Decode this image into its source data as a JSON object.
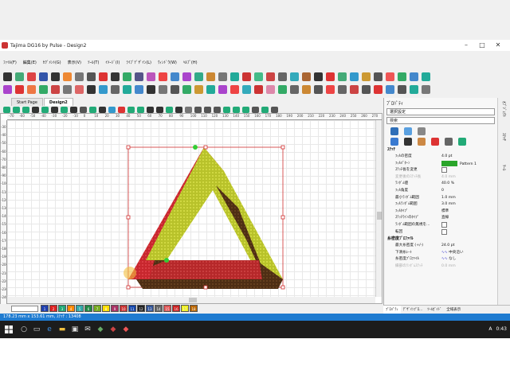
{
  "window": {
    "title": "Tajima DG16 by Pulse - Design2"
  },
  "menu": [
    "ﾌｧｲﾙ(F)",
    "編集(E)",
    "ｾｸﾞﾒﾝﾄ(G)",
    "表示(V)",
    "ﾂｰﾙ(T)",
    "ｲﾒｰｼﾞ(I)",
    "ﾗｲﾌﾞﾃﾞｻﾞｲﾝ(L)",
    "ｳｨﾝﾄﾞｳ(W)",
    "ﾍﾙﾌﾟ(H)"
  ],
  "tabs": [
    {
      "label": "Start Page"
    },
    {
      "label": "Design2"
    }
  ],
  "ruler": {
    "h_ticks": [
      "-70",
      "-60",
      "-50",
      "-40",
      "-30",
      "-20",
      "-10",
      "0",
      "10",
      "20",
      "30",
      "40",
      "50",
      "60",
      "70",
      "80",
      "90",
      "100",
      "110",
      "120",
      "130",
      "140",
      "150",
      "160",
      "170",
      "180",
      "190",
      "200",
      "210",
      "220",
      "230",
      "240",
      "250",
      "260",
      "270"
    ],
    "v_ticks": [
      "-30",
      "-40",
      "-50",
      "-60",
      "-70",
      "-80",
      "-90",
      "-100",
      "-110",
      "-120",
      "-130",
      "-140",
      "-150",
      "-160",
      "-170",
      "-180",
      "-190",
      "-200",
      "-210",
      "-220",
      "-230",
      "-240"
    ]
  },
  "palette": {
    "swatches": [
      "1",
      "2",
      "3",
      "4",
      "5",
      "6",
      "7",
      "8",
      "9",
      "10",
      "11",
      "12",
      "13",
      "14",
      "15",
      "16",
      "17",
      "18"
    ],
    "colors": [
      "#1f3fae",
      "#d22",
      "#2a7",
      "#f80",
      "#3aa",
      "#284",
      "#7a2",
      "#fd0",
      "#a36",
      "#c33",
      "#14a",
      "#222",
      "#359",
      "#666",
      "#d55",
      "#c22",
      "#ee2",
      "#b60"
    ]
  },
  "properties": {
    "title": "ﾌﾟﾛﾊﾟﾃｨ",
    "selector": "選択設定",
    "search_placeholder": "検索",
    "stitch_section": "ｽﾃｯﾁ",
    "rows": [
      {
        "k": "ﾌｨﾙの密度",
        "v": "4.0 pt"
      },
      {
        "k": "ﾌｨﾙﾊﾟﾀｰﾝ",
        "v": "Pattern 1"
      },
      {
        "k": "ｽﾃｯﾁ長を変更",
        "v": ""
      },
      {
        "k": "変更後のｽﾃｯﾁ長",
        "v": "4.0 mm",
        "dim": true
      },
      {
        "k": "ﾗﾝﾀﾞﾑ値",
        "v": "40.0 %"
      },
      {
        "k": "ﾌｨﾙ角度",
        "v": "0"
      },
      {
        "k": "最小ﾗﾝﾀﾞﾑ範囲",
        "v": "1.0 mm"
      },
      {
        "k": "ﾌｨﾙﾗﾝﾀﾞﾑ範囲",
        "v": "3.0 mm"
      },
      {
        "k": "ﾌｨﾙﾀｲﾌﾟ",
        "v": "標準"
      },
      {
        "k": "ｽﾃｯﾁﾗｲﾝのﾀｲﾌﾟ",
        "v": "直線"
      },
      {
        "k": "ﾗﾝﾀﾞﾑ範囲の無視を...",
        "v": ""
      },
      {
        "k": "転回",
        "v": ""
      }
    ],
    "density_section": "糸密度ﾌﾟﾛﾌｧｲﾙ",
    "rows2": [
      {
        "k": "最大糸密度 (+/-)",
        "v": "24.0 pt"
      },
      {
        "k": "下滑糸ﾚｰﾄ",
        "v": "中央沿い"
      },
      {
        "k": "糸密度ﾌﾟﾛﾌｧｲﾙ",
        "v": "なし"
      },
      {
        "k": "縁部のﾗﾝﾀﾞﾑｽﾃｯﾁ",
        "v": "0.0 mm",
        "dim": true
      }
    ]
  },
  "bottom_tabs": [
    "ﾌﾟﾛﾊﾟﾃｨ",
    "ﾃﾞｻﾞｲﾝﾌﾟﾛ...",
    "ﾂｰﾙｶﾞｲﾄﾞ",
    "全域表示"
  ],
  "side_tabs": [
    "ｵﾌﾞｼﾞｪｸﾄ",
    "ｽﾃｯﾁ",
    "ﾂｰﾙ"
  ],
  "status": "178.23 mm x 153.61 mm, ｽﾃｯﾁ : 13408",
  "taskbar": {
    "time": "0:43",
    "ime": "A"
  }
}
